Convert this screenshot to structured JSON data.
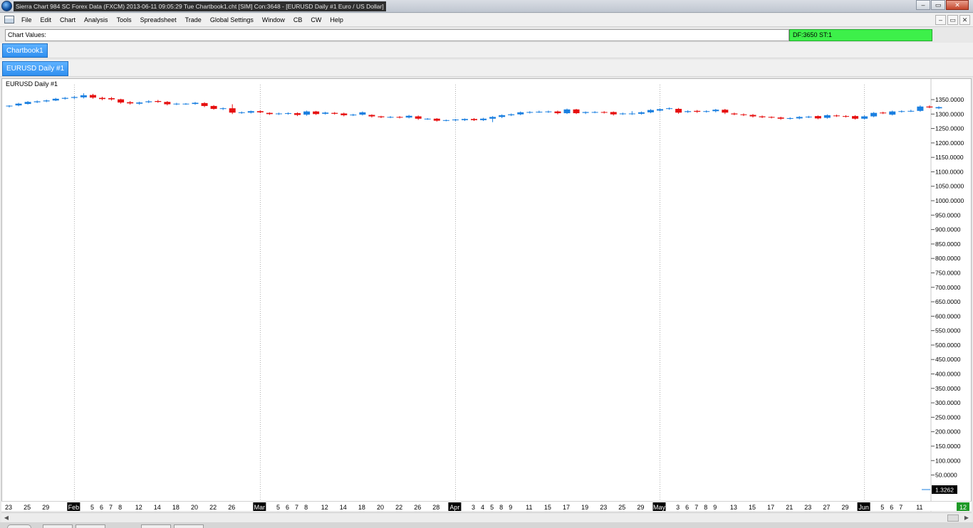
{
  "window": {
    "title": "Sierra Chart 984 SC Forex Data (FXCM) 2013-06-11  09:05:29 Tue  Chartbook1.cht [SIM] Con:3648 - [EURUSD  Daily  #1  Euro / US Dollar]",
    "minimize_icon": "minimize-icon",
    "maximize_icon": "maximize-icon",
    "close_icon": "close-icon"
  },
  "menu": {
    "items": [
      "File",
      "Edit",
      "Chart",
      "Analysis",
      "Tools",
      "Spreadsheet",
      "Trade",
      "Global Settings",
      "Window",
      "CB",
      "CW",
      "Help"
    ],
    "mdi_buttons": [
      "–",
      "▭",
      "✕"
    ]
  },
  "values_bar": {
    "label": "Chart Values:",
    "status": "DF:3650  ST:1",
    "status_color": "#3df04a"
  },
  "chartbook_tab": "Chartbook1",
  "chart_tab": "EURUSD  Daily  #1",
  "chart": {
    "label": "EURUSD  Daily  #1",
    "last_price": "1.3262",
    "corner_label": "12"
  },
  "chart_data": {
    "type": "candlestick",
    "symbol": "EURUSD",
    "timeframe": "Daily",
    "colors": {
      "up": "#1a7fe0",
      "down": "#e60f0f",
      "last_price_bg": "#000000"
    },
    "y_ticks": [
      "1350.0000",
      "1300.0000",
      "1250.0000",
      "1200.0000",
      "1150.0000",
      "1100.0000",
      "1050.0000",
      "1000.0000",
      "950.0000",
      "900.0000",
      "850.0000",
      "800.0000",
      "750.0000",
      "700.0000",
      "650.0000",
      "600.0000",
      "550.0000",
      "500.0000",
      "450.0000",
      "400.0000",
      "350.0000",
      "300.0000",
      "250.0000",
      "200.0000",
      "150.0000",
      "100.0000",
      "50.0000"
    ],
    "ylim": [
      0,
      1375
    ],
    "x_ticks": [
      {
        "label": "23",
        "month": false,
        "c": 0
      },
      {
        "label": "25",
        "month": false,
        "c": 2
      },
      {
        "label": "29",
        "month": false,
        "c": 4
      },
      {
        "label": "Feb",
        "month": true,
        "c": 7
      },
      {
        "label": "5",
        "month": false,
        "c": 9
      },
      {
        "label": "6",
        "month": false,
        "c": 10
      },
      {
        "label": "7",
        "month": false,
        "c": 11
      },
      {
        "label": "8",
        "month": false,
        "c": 12
      },
      {
        "label": "12",
        "month": false,
        "c": 14
      },
      {
        "label": "14",
        "month": false,
        "c": 16
      },
      {
        "label": "18",
        "month": false,
        "c": 18
      },
      {
        "label": "20",
        "month": false,
        "c": 20
      },
      {
        "label": "22",
        "month": false,
        "c": 22
      },
      {
        "label": "26",
        "month": false,
        "c": 24
      },
      {
        "label": "Mar",
        "month": true,
        "c": 27
      },
      {
        "label": "5",
        "month": false,
        "c": 29
      },
      {
        "label": "6",
        "month": false,
        "c": 30
      },
      {
        "label": "7",
        "month": false,
        "c": 31
      },
      {
        "label": "8",
        "month": false,
        "c": 32
      },
      {
        "label": "12",
        "month": false,
        "c": 34
      },
      {
        "label": "14",
        "month": false,
        "c": 36
      },
      {
        "label": "18",
        "month": false,
        "c": 38
      },
      {
        "label": "20",
        "month": false,
        "c": 40
      },
      {
        "label": "22",
        "month": false,
        "c": 42
      },
      {
        "label": "26",
        "month": false,
        "c": 44
      },
      {
        "label": "28",
        "month": false,
        "c": 46
      },
      {
        "label": "Apr",
        "month": true,
        "c": 48
      },
      {
        "label": "3",
        "month": false,
        "c": 50
      },
      {
        "label": "4",
        "month": false,
        "c": 51
      },
      {
        "label": "5",
        "month": false,
        "c": 52
      },
      {
        "label": "8",
        "month": false,
        "c": 53
      },
      {
        "label": "9",
        "month": false,
        "c": 54
      },
      {
        "label": "11",
        "month": false,
        "c": 56
      },
      {
        "label": "15",
        "month": false,
        "c": 58
      },
      {
        "label": "17",
        "month": false,
        "c": 60
      },
      {
        "label": "19",
        "month": false,
        "c": 62
      },
      {
        "label": "23",
        "month": false,
        "c": 64
      },
      {
        "label": "25",
        "month": false,
        "c": 66
      },
      {
        "label": "29",
        "month": false,
        "c": 68
      },
      {
        "label": "May",
        "month": true,
        "c": 70
      },
      {
        "label": "3",
        "month": false,
        "c": 72
      },
      {
        "label": "6",
        "month": false,
        "c": 73
      },
      {
        "label": "7",
        "month": false,
        "c": 74
      },
      {
        "label": "8",
        "month": false,
        "c": 75
      },
      {
        "label": "9",
        "month": false,
        "c": 76
      },
      {
        "label": "13",
        "month": false,
        "c": 78
      },
      {
        "label": "15",
        "month": false,
        "c": 80
      },
      {
        "label": "17",
        "month": false,
        "c": 82
      },
      {
        "label": "21",
        "month": false,
        "c": 84
      },
      {
        "label": "23",
        "month": false,
        "c": 86
      },
      {
        "label": "27",
        "month": false,
        "c": 88
      },
      {
        "label": "29",
        "month": false,
        "c": 90
      },
      {
        "label": "Jun",
        "month": true,
        "c": 92
      },
      {
        "label": "5",
        "month": false,
        "c": 94
      },
      {
        "label": "6",
        "month": false,
        "c": 95
      },
      {
        "label": "7",
        "month": false,
        "c": 96
      },
      {
        "label": "11",
        "month": false,
        "c": 98
      }
    ],
    "candles": [
      {
        "o": 1327,
        "c": 1329,
        "h": 1331,
        "l": 1323
      },
      {
        "o": 1330,
        "c": 1336,
        "h": 1339,
        "l": 1327
      },
      {
        "o": 1335,
        "c": 1342,
        "h": 1345,
        "l": 1333
      },
      {
        "o": 1341,
        "c": 1344,
        "h": 1347,
        "l": 1338
      },
      {
        "o": 1344,
        "c": 1347,
        "h": 1350,
        "l": 1341
      },
      {
        "o": 1347,
        "c": 1353,
        "h": 1356,
        "l": 1345
      },
      {
        "o": 1353,
        "c": 1356,
        "h": 1359,
        "l": 1350
      },
      {
        "o": 1356,
        "c": 1359,
        "h": 1362,
        "l": 1352
      },
      {
        "o": 1358,
        "c": 1365,
        "h": 1372,
        "l": 1354
      },
      {
        "o": 1366,
        "c": 1357,
        "h": 1370,
        "l": 1353
      },
      {
        "o": 1356,
        "c": 1352,
        "h": 1360,
        "l": 1348
      },
      {
        "o": 1355,
        "c": 1351,
        "h": 1359,
        "l": 1347
      },
      {
        "o": 1351,
        "c": 1340,
        "h": 1353,
        "l": 1336
      },
      {
        "o": 1341,
        "c": 1337,
        "h": 1345,
        "l": 1333
      },
      {
        "o": 1336,
        "c": 1340,
        "h": 1343,
        "l": 1332
      },
      {
        "o": 1341,
        "c": 1344,
        "h": 1348,
        "l": 1338
      },
      {
        "o": 1345,
        "c": 1342,
        "h": 1349,
        "l": 1339
      },
      {
        "o": 1342,
        "c": 1334,
        "h": 1345,
        "l": 1330
      },
      {
        "o": 1334,
        "c": 1336,
        "h": 1339,
        "l": 1331
      },
      {
        "o": 1335,
        "c": 1336,
        "h": 1338,
        "l": 1332
      },
      {
        "o": 1335,
        "c": 1339,
        "h": 1342,
        "l": 1332
      },
      {
        "o": 1338,
        "c": 1328,
        "h": 1341,
        "l": 1324
      },
      {
        "o": 1328,
        "c": 1318,
        "h": 1331,
        "l": 1315
      },
      {
        "o": 1318,
        "c": 1320,
        "h": 1323,
        "l": 1314
      },
      {
        "o": 1320,
        "c": 1305,
        "h": 1334,
        "l": 1300
      },
      {
        "o": 1305,
        "c": 1306,
        "h": 1309,
        "l": 1301
      },
      {
        "o": 1305,
        "c": 1310,
        "h": 1312,
        "l": 1302
      },
      {
        "o": 1310,
        "c": 1306,
        "h": 1313,
        "l": 1303
      },
      {
        "o": 1304,
        "c": 1300,
        "h": 1306,
        "l": 1297
      },
      {
        "o": 1300,
        "c": 1302,
        "h": 1305,
        "l": 1297
      },
      {
        "o": 1301,
        "c": 1303,
        "h": 1306,
        "l": 1298
      },
      {
        "o": 1303,
        "c": 1297,
        "h": 1306,
        "l": 1293
      },
      {
        "o": 1298,
        "c": 1309,
        "h": 1312,
        "l": 1294
      },
      {
        "o": 1309,
        "c": 1300,
        "h": 1311,
        "l": 1297
      },
      {
        "o": 1301,
        "c": 1305,
        "h": 1308,
        "l": 1298
      },
      {
        "o": 1304,
        "c": 1301,
        "h": 1307,
        "l": 1298
      },
      {
        "o": 1302,
        "c": 1296,
        "h": 1305,
        "l": 1292
      },
      {
        "o": 1296,
        "c": 1298,
        "h": 1301,
        "l": 1293
      },
      {
        "o": 1298,
        "c": 1306,
        "h": 1309,
        "l": 1295
      },
      {
        "o": 1297,
        "c": 1292,
        "h": 1299,
        "l": 1288
      },
      {
        "o": 1292,
        "c": 1289,
        "h": 1294,
        "l": 1286
      },
      {
        "o": 1289,
        "c": 1290,
        "h": 1293,
        "l": 1286
      },
      {
        "o": 1290,
        "c": 1288,
        "h": 1293,
        "l": 1285
      },
      {
        "o": 1288,
        "c": 1294,
        "h": 1297,
        "l": 1285
      },
      {
        "o": 1292,
        "c": 1284,
        "h": 1295,
        "l": 1280
      },
      {
        "o": 1283,
        "c": 1284,
        "h": 1286,
        "l": 1280
      },
      {
        "o": 1284,
        "c": 1277,
        "h": 1286,
        "l": 1274
      },
      {
        "o": 1277,
        "c": 1279,
        "h": 1281,
        "l": 1275
      },
      {
        "o": 1279,
        "c": 1281,
        "h": 1283,
        "l": 1276
      },
      {
        "o": 1279,
        "c": 1283,
        "h": 1285,
        "l": 1276
      },
      {
        "o": 1283,
        "c": 1279,
        "h": 1286,
        "l": 1276
      },
      {
        "o": 1279,
        "c": 1284,
        "h": 1287,
        "l": 1276
      },
      {
        "o": 1284,
        "c": 1290,
        "h": 1293,
        "l": 1272
      },
      {
        "o": 1290,
        "c": 1296,
        "h": 1299,
        "l": 1286
      },
      {
        "o": 1296,
        "c": 1299,
        "h": 1302,
        "l": 1293
      },
      {
        "o": 1299,
        "c": 1306,
        "h": 1309,
        "l": 1296
      },
      {
        "o": 1306,
        "c": 1307,
        "h": 1310,
        "l": 1302
      },
      {
        "o": 1307,
        "c": 1308,
        "h": 1312,
        "l": 1304
      },
      {
        "o": 1307,
        "c": 1309,
        "h": 1312,
        "l": 1304
      },
      {
        "o": 1309,
        "c": 1303,
        "h": 1312,
        "l": 1299
      },
      {
        "o": 1303,
        "c": 1316,
        "h": 1319,
        "l": 1300
      },
      {
        "o": 1316,
        "c": 1303,
        "h": 1318,
        "l": 1300
      },
      {
        "o": 1304,
        "c": 1307,
        "h": 1309,
        "l": 1300
      },
      {
        "o": 1306,
        "c": 1307,
        "h": 1310,
        "l": 1303
      },
      {
        "o": 1307,
        "c": 1306,
        "h": 1310,
        "l": 1302
      },
      {
        "o": 1307,
        "c": 1299,
        "h": 1309,
        "l": 1295
      },
      {
        "o": 1300,
        "c": 1302,
        "h": 1305,
        "l": 1297
      },
      {
        "o": 1300,
        "c": 1302,
        "h": 1310,
        "l": 1297
      },
      {
        "o": 1301,
        "c": 1306,
        "h": 1309,
        "l": 1298
      },
      {
        "o": 1306,
        "c": 1314,
        "h": 1317,
        "l": 1303
      },
      {
        "o": 1312,
        "c": 1317,
        "h": 1319,
        "l": 1309
      },
      {
        "o": 1319,
        "c": 1320,
        "h": 1323,
        "l": 1315
      },
      {
        "o": 1318,
        "c": 1305,
        "h": 1321,
        "l": 1301
      },
      {
        "o": 1307,
        "c": 1310,
        "h": 1313,
        "l": 1304
      },
      {
        "o": 1311,
        "c": 1308,
        "h": 1314,
        "l": 1304
      },
      {
        "o": 1309,
        "c": 1310,
        "h": 1313,
        "l": 1305
      },
      {
        "o": 1310,
        "c": 1315,
        "h": 1318,
        "l": 1306
      },
      {
        "o": 1315,
        "c": 1305,
        "h": 1318,
        "l": 1300
      },
      {
        "o": 1302,
        "c": 1299,
        "h": 1305,
        "l": 1296
      },
      {
        "o": 1299,
        "c": 1297,
        "h": 1302,
        "l": 1293
      },
      {
        "o": 1297,
        "c": 1292,
        "h": 1300,
        "l": 1288
      },
      {
        "o": 1292,
        "c": 1289,
        "h": 1295,
        "l": 1286
      },
      {
        "o": 1290,
        "c": 1288,
        "h": 1292,
        "l": 1285
      },
      {
        "o": 1288,
        "c": 1284,
        "h": 1291,
        "l": 1280
      },
      {
        "o": 1284,
        "c": 1286,
        "h": 1289,
        "l": 1281
      },
      {
        "o": 1285,
        "c": 1290,
        "h": 1293,
        "l": 1282
      },
      {
        "o": 1289,
        "c": 1291,
        "h": 1294,
        "l": 1286
      },
      {
        "o": 1293,
        "c": 1285,
        "h": 1295,
        "l": 1282
      },
      {
        "o": 1287,
        "c": 1296,
        "h": 1299,
        "l": 1284
      },
      {
        "o": 1295,
        "c": 1293,
        "h": 1298,
        "l": 1290
      },
      {
        "o": 1293,
        "c": 1291,
        "h": 1296,
        "l": 1288
      },
      {
        "o": 1293,
        "c": 1284,
        "h": 1296,
        "l": 1281
      },
      {
        "o": 1284,
        "c": 1292,
        "h": 1295,
        "l": 1281
      },
      {
        "o": 1292,
        "c": 1304,
        "h": 1307,
        "l": 1289
      },
      {
        "o": 1305,
        "c": 1303,
        "h": 1308,
        "l": 1300
      },
      {
        "o": 1298,
        "c": 1309,
        "h": 1312,
        "l": 1295
      },
      {
        "o": 1308,
        "c": 1310,
        "h": 1313,
        "l": 1305
      },
      {
        "o": 1310,
        "c": 1311,
        "h": 1315,
        "l": 1307
      },
      {
        "o": 1311,
        "c": 1326,
        "h": 1330,
        "l": 1308
      },
      {
        "o": 1326,
        "c": 1323,
        "h": 1330,
        "l": 1320
      },
      {
        "o": 1320,
        "c": 1324,
        "h": 1327,
        "l": 1317
      }
    ]
  }
}
